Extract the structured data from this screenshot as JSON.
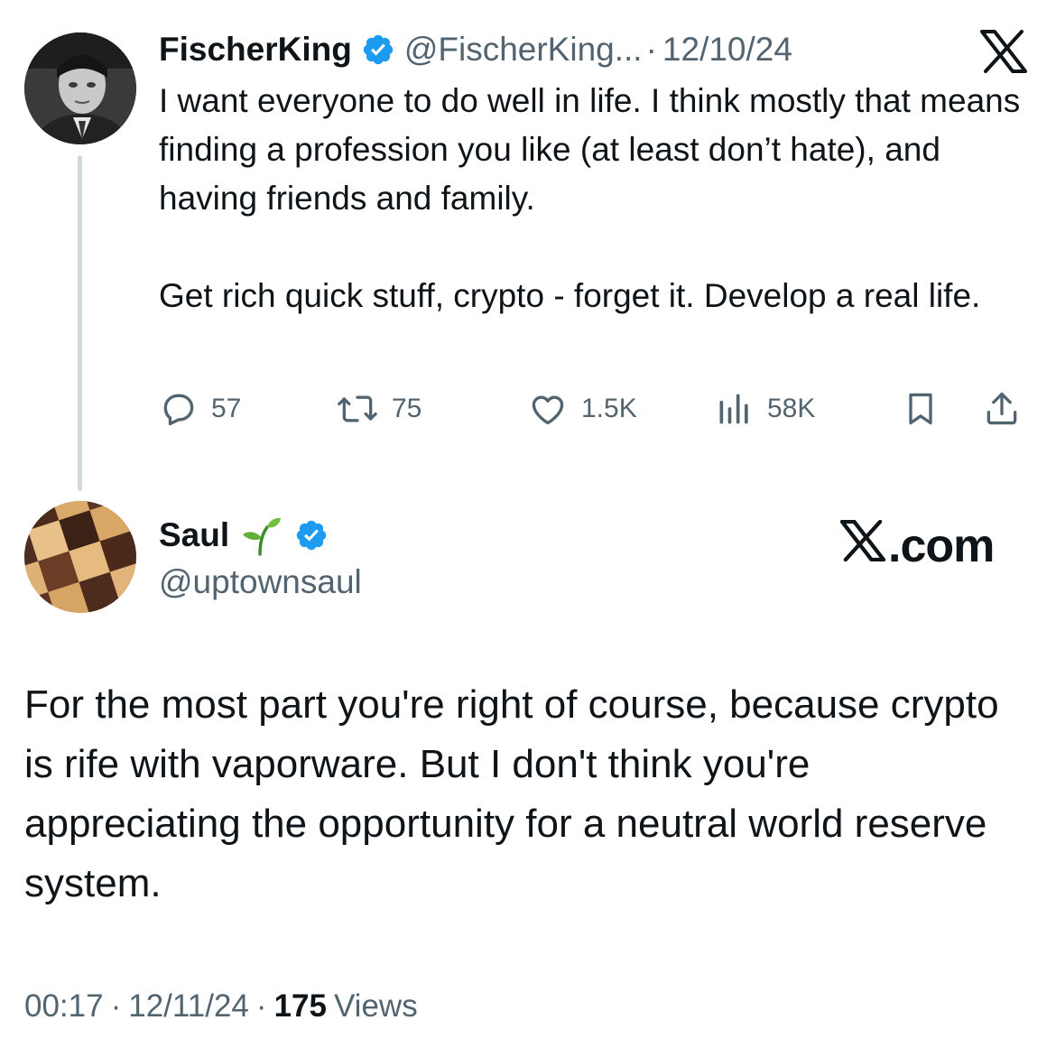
{
  "original_tweet": {
    "display_name": "FischerKing",
    "verified": true,
    "handle": "@FischerKing...",
    "separator": "·",
    "date": "12/10/24",
    "platform_icon": "x-logo-icon",
    "text_paragraphs": [
      "I want everyone to do well in life. I think mostly that means finding a profession you like (at least don’t hate), and having friends and family.",
      "Get rich quick stuff, crypto - forget it. Develop a real life."
    ],
    "actions": {
      "replies": "57",
      "reposts": "75",
      "likes": "1.5K",
      "views": "58K"
    }
  },
  "reply_tweet": {
    "display_name": "Saul",
    "name_emoji_icon": "seedling-icon",
    "verified": true,
    "handle": "@uptownsaul",
    "watermark": ".com",
    "watermark_icon": "x-logo-icon",
    "text": "For the most part you're right of course, because crypto is rife with vaporware. But I don't think you're appreciating the opportunity for a neutral world reserve system.",
    "meta": {
      "time": "00:17",
      "date": "12/11/24",
      "separator": "·",
      "views_count": "175",
      "views_label": "Views"
    }
  },
  "colors": {
    "text_primary": "#0f1419",
    "text_secondary": "#536471",
    "verified_blue": "#1d9bf0",
    "thread_line": "#cfd9de"
  }
}
